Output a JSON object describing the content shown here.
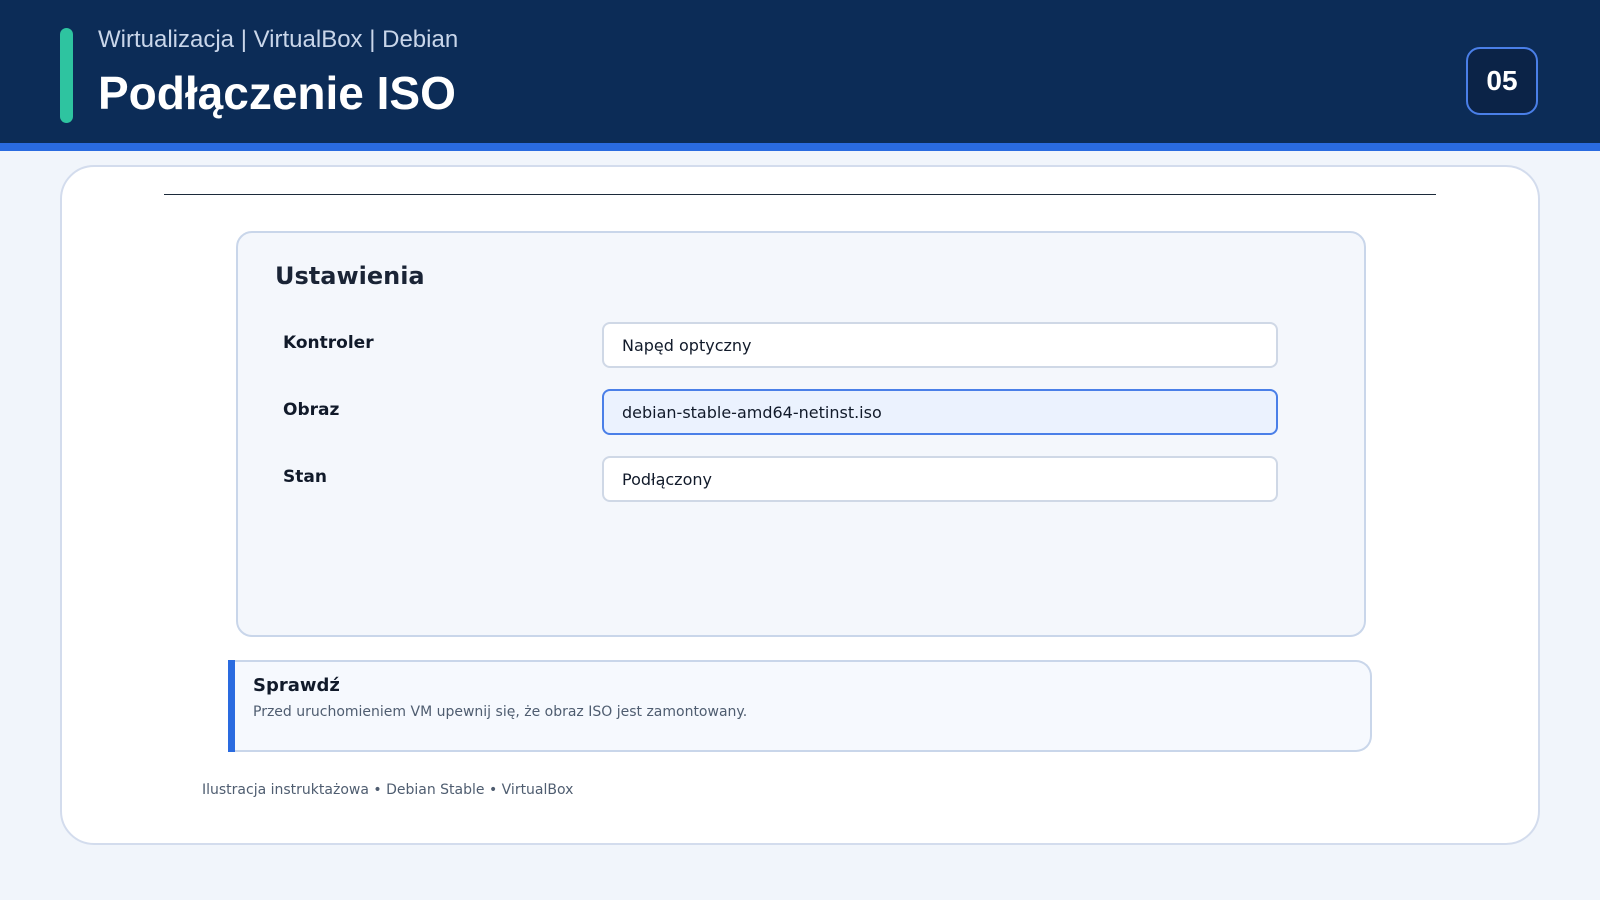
{
  "header": {
    "subtitle": "Wirtualizacja | VirtualBox | Debian",
    "title": "Podłączenie ISO",
    "page_number": "05"
  },
  "settings": {
    "heading": "Ustawienia",
    "fields": [
      {
        "label": "Kontroler",
        "value": "Napęd optyczny"
      },
      {
        "label": "Obraz",
        "value": "debian-stable-amd64-netinst.iso",
        "active": true
      },
      {
        "label": "Stan",
        "value": "Podłączony"
      }
    ]
  },
  "note": {
    "title": "Sprawdź",
    "text": "Przed uruchomieniem VM upewnij się, że obraz ISO jest zamontowany."
  },
  "footer": {
    "text": "Ilustracja instruktażowa • Debian Stable • VirtualBox"
  },
  "colors": {
    "header_background": "#0c2c57",
    "accent_blue": "#2a6be0",
    "marker_green": "#2ec4a0",
    "page_background": "#f1f5fb"
  }
}
